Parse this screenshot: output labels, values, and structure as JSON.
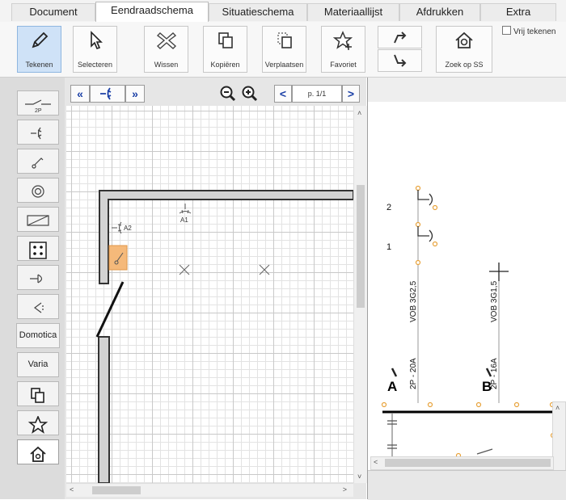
{
  "tabs": [
    {
      "label": "Document",
      "active": false
    },
    {
      "label": "Eendraadschema",
      "active": true
    },
    {
      "label": "Situatieschema",
      "active": false
    },
    {
      "label": "Materiaallijst",
      "active": false
    },
    {
      "label": "Afdrukken",
      "active": false
    },
    {
      "label": "Extra",
      "active": false
    }
  ],
  "ribbon": {
    "draw_label": "Tekenen",
    "select_label": "Selecteren",
    "delete_label": "Wissen",
    "copy_label": "Kopiëren",
    "move_label": "Verplaatsen",
    "favorite_label": "Favoriet",
    "search_label": "Zoek op SS",
    "free_draw_label": "Vrij tekenen"
  },
  "sidebar": {
    "items": [
      {
        "icon": "double-pole-switch-icon",
        "label": "2P"
      },
      {
        "icon": "socket-icon"
      },
      {
        "icon": "switch-icon"
      },
      {
        "icon": "lamp-ring-icon"
      },
      {
        "icon": "rectangle-component-icon"
      },
      {
        "icon": "dots-box-icon"
      },
      {
        "icon": "plug-icon"
      },
      {
        "icon": "triangle-speaker-icon"
      },
      {
        "label": "Domotica"
      },
      {
        "label": "Varia"
      },
      {
        "icon": "copy-icon"
      },
      {
        "icon": "star-icon"
      },
      {
        "icon": "house-icon"
      }
    ]
  },
  "canvas": {
    "page_indicator": "p. 1/1",
    "labels": {
      "a2": "A2",
      "a1": "A1"
    }
  },
  "schema": {
    "circuit_numbers": [
      "2",
      "1"
    ],
    "cable_labels": [
      "VOB 3G2,5",
      "VOB 3G1,5"
    ],
    "breaker_labels": [
      "2P - 20A",
      "2P - 16A"
    ],
    "circuit_letters": [
      "A",
      "B"
    ]
  },
  "colors": {
    "accent": "#cfe2f7",
    "wall": "#555555",
    "highlight": "#f5b97a",
    "connector": "#e8a33c"
  }
}
